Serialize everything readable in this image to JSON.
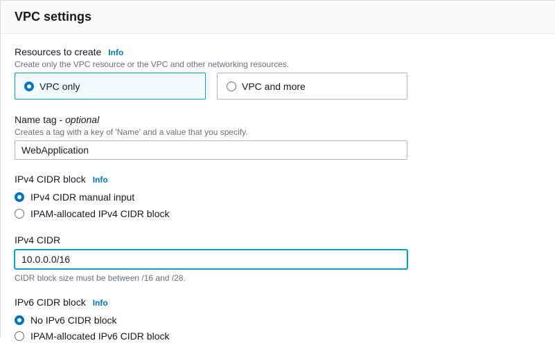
{
  "panel": {
    "title": "VPC settings"
  },
  "resources": {
    "label": "Resources to create",
    "info": "Info",
    "description": "Create only the VPC resource or the VPC and other networking resources.",
    "options": [
      {
        "label": "VPC only",
        "selected": true
      },
      {
        "label": "VPC and more",
        "selected": false
      }
    ]
  },
  "name_tag": {
    "label": "Name tag - ",
    "optional": "optional",
    "description": "Creates a tag with a key of 'Name' and a value that you specify.",
    "value": "WebApplication"
  },
  "ipv4_block": {
    "label": "IPv4 CIDR block",
    "info": "Info",
    "options": [
      {
        "label": "IPv4 CIDR manual input",
        "selected": true
      },
      {
        "label": "IPAM-allocated IPv4 CIDR block",
        "selected": false
      }
    ]
  },
  "ipv4_cidr": {
    "label": "IPv4 CIDR",
    "value": "10.0.0.0/16",
    "hint": "CIDR block size must be between /16 and /28."
  },
  "ipv6_block": {
    "label": "IPv6 CIDR block",
    "info": "Info",
    "options": [
      {
        "label": "No IPv6 CIDR block",
        "selected": true
      },
      {
        "label": "IPAM-allocated IPv6 CIDR block",
        "selected": false
      }
    ]
  },
  "colors": {
    "accent": "#0073bb",
    "focus": "#00a1c9",
    "selected_bg": "#f1faff"
  }
}
